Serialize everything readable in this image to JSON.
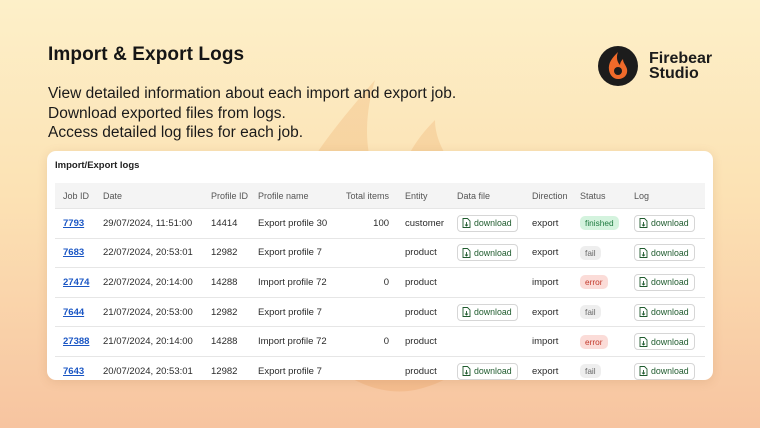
{
  "heading": "Import & Export Logs",
  "description": [
    "View detailed information about each import and export job.",
    "Download exported files from logs.",
    "Access detailed log files for each job."
  ],
  "brand": {
    "line1": "Firebear",
    "line2": "Studio"
  },
  "panel": {
    "title": "Import/Export logs",
    "columns": [
      "Job ID",
      "Date",
      "Profile ID",
      "Profile name",
      "Total items",
      "Entity",
      "Data file",
      "Direction",
      "Status",
      "Log"
    ],
    "download_label": "download",
    "rows": [
      {
        "job_id": "7793",
        "date": "29/07/2024, 11:51:00",
        "profile_id": "14414",
        "profile_name": "Export profile 30",
        "total": "100",
        "entity": "customer",
        "data_file": "download",
        "direction": "export",
        "status": "finished",
        "log": "download"
      },
      {
        "job_id": "7683",
        "date": "22/07/2024, 20:53:01",
        "profile_id": "12982",
        "profile_name": "Export profile 7",
        "total": "",
        "entity": "product",
        "data_file": "download",
        "direction": "export",
        "status": "fail",
        "log": "download"
      },
      {
        "job_id": "27474",
        "date": "22/07/2024, 20:14:00",
        "profile_id": "14288",
        "profile_name": "Import profile 72",
        "total": "0",
        "entity": "product",
        "data_file": "",
        "direction": "import",
        "status": "error",
        "log": "download"
      },
      {
        "job_id": "7644",
        "date": "21/07/2024, 20:53:00",
        "profile_id": "12982",
        "profile_name": "Export profile 7",
        "total": "",
        "entity": "product",
        "data_file": "download",
        "direction": "export",
        "status": "fail",
        "log": "download"
      },
      {
        "job_id": "27388",
        "date": "21/07/2024, 20:14:00",
        "profile_id": "14288",
        "profile_name": "Import profile 72",
        "total": "0",
        "entity": "product",
        "data_file": "",
        "direction": "import",
        "status": "error",
        "log": "download"
      },
      {
        "job_id": "7643",
        "date": "20/07/2024, 20:53:01",
        "profile_id": "12982",
        "profile_name": "Export profile 7",
        "total": "",
        "entity": "product",
        "data_file": "download",
        "direction": "export",
        "status": "fail",
        "log": "download"
      }
    ]
  },
  "colors": {
    "link": "#1a56c4",
    "download_text": "#1f5b2e",
    "finished": "#1d7a3f",
    "error": "#c2392b"
  },
  "icons": {
    "download": "file-download-icon",
    "brand": "firebear-logo-icon"
  }
}
